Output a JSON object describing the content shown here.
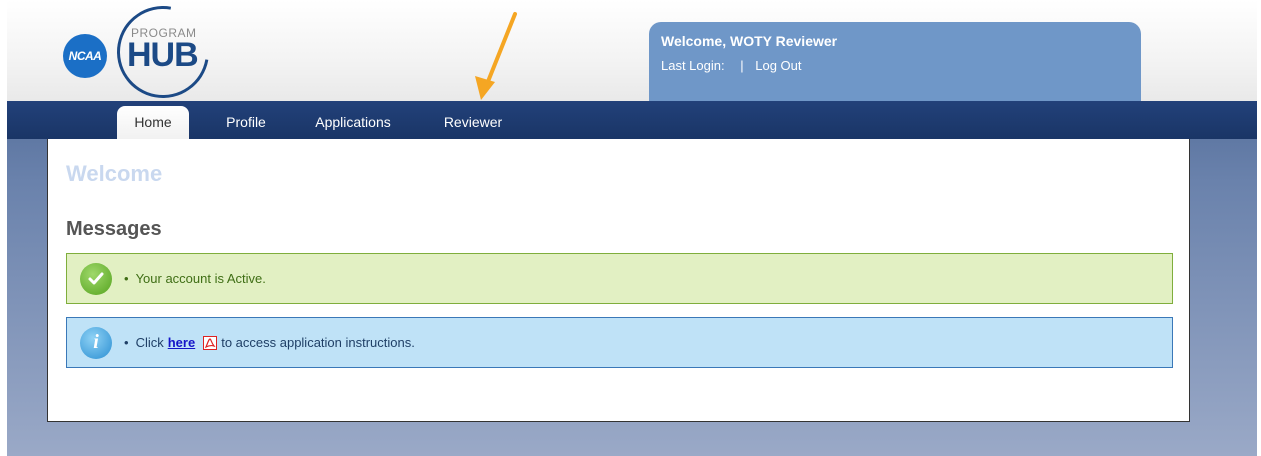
{
  "header": {
    "logo": {
      "badge": "NCAA",
      "small_text": "PROGRAM",
      "big_text": "HUB"
    },
    "welcome": {
      "greeting": "Welcome, WOTY Reviewer",
      "last_login_label": "Last Login:",
      "separator": "|",
      "logout_label": "Log Out"
    }
  },
  "nav": {
    "items": [
      {
        "label": "Home",
        "active": true
      },
      {
        "label": "Profile",
        "active": false
      },
      {
        "label": "Applications",
        "active": false
      },
      {
        "label": "Reviewer",
        "active": false
      }
    ]
  },
  "main": {
    "page_title": "Welcome",
    "messages_title": "Messages",
    "messages": [
      {
        "type": "success",
        "icon": "check-icon",
        "bullet": "•",
        "text": "Your account is Active."
      },
      {
        "type": "info",
        "icon": "info-icon",
        "bullet": "•",
        "prefix": "Click",
        "link_text": "here",
        "link_icon": "pdf-icon",
        "suffix": "to access application instructions."
      }
    ]
  },
  "colors": {
    "navbar": "#1a3566",
    "welcome_box": "#6f97c8",
    "success_bg": "#e2f0c3",
    "info_bg": "#bfe2f7",
    "annotation_arrow": "#f5a623"
  }
}
